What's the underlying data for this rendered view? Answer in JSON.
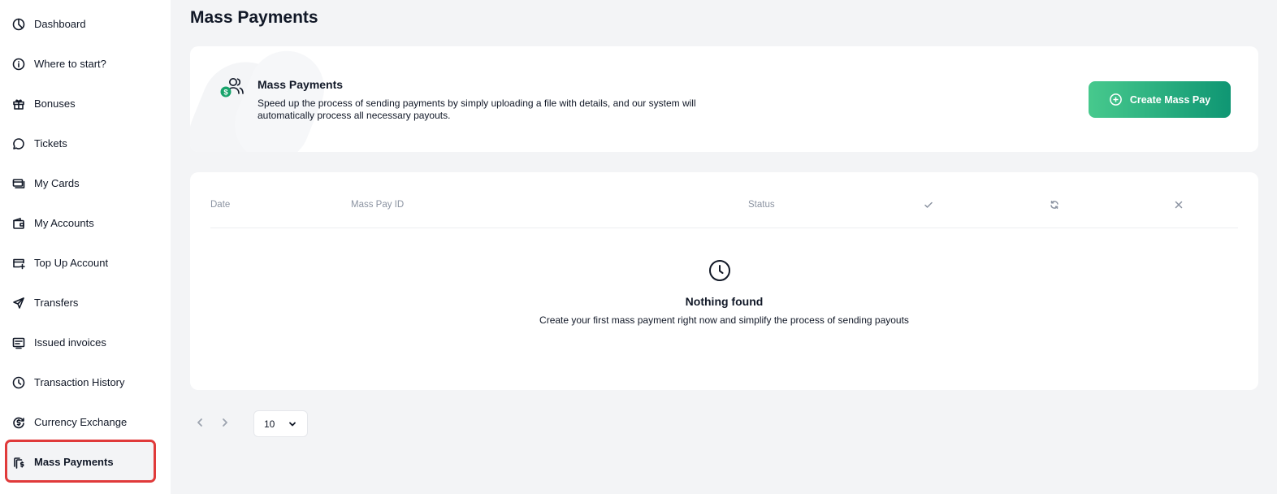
{
  "sidebar": {
    "items": [
      {
        "label": "Dashboard",
        "icon": "pie-chart-icon"
      },
      {
        "label": "Where to start?",
        "icon": "info-icon"
      },
      {
        "label": "Bonuses",
        "icon": "gift-icon"
      },
      {
        "label": "Tickets",
        "icon": "chat-icon"
      },
      {
        "label": "My Cards",
        "icon": "cards-icon"
      },
      {
        "label": "My Accounts",
        "icon": "wallet-icon"
      },
      {
        "label": "Top Up Account",
        "icon": "card-plus-icon"
      },
      {
        "label": "Transfers",
        "icon": "send-icon"
      },
      {
        "label": "Issued invoices",
        "icon": "invoice-icon"
      },
      {
        "label": "Transaction History",
        "icon": "clock-icon"
      },
      {
        "label": "Currency Exchange",
        "icon": "exchange-icon"
      },
      {
        "label": "Mass Payments",
        "icon": "mass-payments-icon",
        "active": true
      }
    ]
  },
  "page": {
    "title": "Mass Payments"
  },
  "hero": {
    "title": "Mass Payments",
    "description": "Speed up the process of sending payments by simply uploading a file with details, and our system will automatically process all necessary payouts.",
    "button_label": "Create Mass Pay",
    "icon": "users-dollar-icon"
  },
  "table": {
    "columns": {
      "date": "Date",
      "mass_pay_id": "Mass Pay ID",
      "status": "Status"
    },
    "status_icons": [
      "check-icon",
      "refresh-icon",
      "close-icon"
    ],
    "empty": {
      "title": "Nothing found",
      "description": "Create your first mass payment right now and simplify the process of sending payouts"
    }
  },
  "pagination": {
    "page_size": "10"
  },
  "colors": {
    "accent_start": "#47c98d",
    "accent_end": "#0f9673",
    "active_outline": "#e03a3a"
  }
}
